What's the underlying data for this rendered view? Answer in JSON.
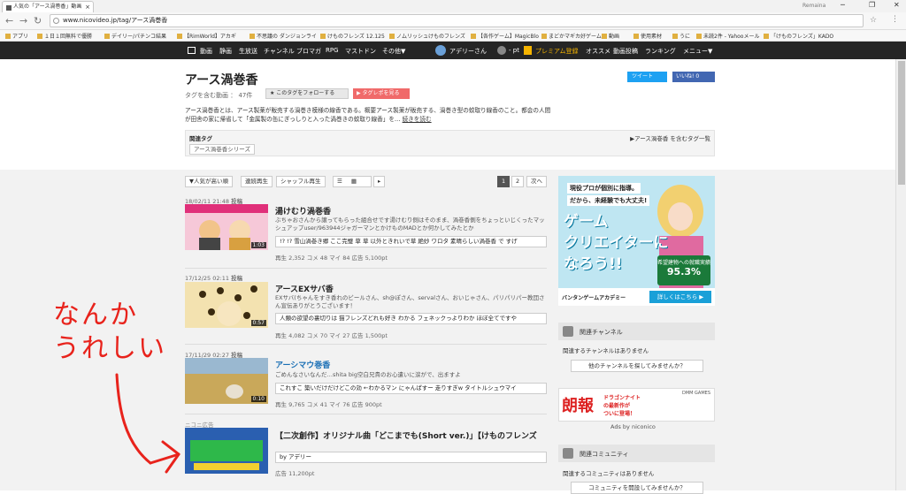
{
  "browser": {
    "tab_title": "人気の「アース渦巻香」動画",
    "tab_close": "×",
    "profile": "Remaina",
    "win_min": "─",
    "win_max": "❐",
    "win_close": "✕",
    "back": "←",
    "forward": "→",
    "reload": "↻",
    "url": "www.nicovideo.jp/tag/アース渦巻香",
    "bookmarks": [
      "アプリ",
      "１日１回無料で優勝",
      "デイリー/パチンコ結果",
      "【RimWorld】アカギ",
      "不思議の ダンジョンライ",
      "けものフレンズ 12.125",
      "ノムリッシュけものフレンズ",
      "【各作ゲーム】MagicBlo",
      "まどかマギカ好ゲーム",
      "動画",
      "使用素材",
      "うに",
      "未読2件 - Yahooメール",
      "「けものフレンズ」KADO"
    ]
  },
  "nicobar": {
    "items": [
      "動画",
      "静画",
      "生放送",
      "チャンネル",
      "ブロマガ",
      "RPG",
      "マストドン",
      "その他▼"
    ],
    "user": "アデリーさん",
    "points": "- pt",
    "premium": "プレミアム登録",
    "right_items": [
      "オススメ",
      "動画投稿",
      "ランキング",
      "メニュー▼"
    ]
  },
  "header": {
    "title": "アース渦巻香",
    "count": "タグを含む動画 ： 47件",
    "follow": "★ このタグをフォローする",
    "report": "▶ タグレポを見る",
    "tweet": "ツイート",
    "fb": "いいね! 0",
    "desc_line1": "アース渦巻香とは、アース製薬が販売する渦巻き模様の線香である。概要アース製薬が販売する、渦巻き型の蚊取り線香のこと。都会の人間",
    "desc_line2": "が田舎の家に帰省して「金属製の缶にぎっしりと入った渦巻きの蚊取り線香」を…",
    "desc_link": "続きを読む",
    "reltag_label": "関連タグ",
    "reltag_chip": "アース渦巻香シリーズ",
    "reltag_list": "▶アース渦巻香 を含むタグ一覧"
  },
  "sort": {
    "popular": "▼人気が高い順",
    "continuous": "連続再生",
    "shuffle": "シャッフル再生",
    "view_list": "☰",
    "view_grid": "▦",
    "more": "▸",
    "page1": "1",
    "page2": "2",
    "next": "次へ"
  },
  "videos": [
    {
      "date": "18/02/11 21:48",
      "posted": "投稿",
      "title": "湯けむり渦巻香",
      "desc": "ぶちゃおさんから譲ってもらった組合せです湯けむり側はそのまま、渦巻香側をちょっといじくったマッシュアップuser/963944ジャガーマンとかけものMADとか何かしてみたとか",
      "duration": "1:03",
      "comment": "!? !? 雪山渦巻き郷 ここ完璧 草 草 以外ときれいで草 絶妙 ワロタ 素晴らしい渦巻香 で すげ",
      "stats": "再生 2,352  コメ 48  マイ 84  広告 5,100pt"
    },
    {
      "date": "17/12/25 02:11",
      "posted": "投稿",
      "title": "アースEXサバ香",
      "desc": "EXサバ(ちゃんをすき香れのビールさん、sh@ぽさん、servalさん、おいじゃさん、パリパリパー教団さん宣伝ありがとうございます！",
      "duration": "0:57",
      "comment": "人類の欲望の裏切りは 猫フレンズどれも好き わかる フェネックっよりわか ほぼ全てですや",
      "stats": "再生 4,082  コメ 70  マイ 27  広告 1,500pt"
    },
    {
      "date": "17/11/29 02:27",
      "posted": "投稿",
      "title": "アーシマウ巻香",
      "desc": "ごめんなさいなんだ…shita big空白兄貴のお心遣いに涙がで、出ますよ",
      "duration": "0:10",
      "comment": "これすこ 築いだけだけどこの効 ←わかるマン にゃんぱすー 走りすぎw タイトルシュウマイ",
      "stats": "再生 9,765  コメ 41  マイ 76  広告 900pt"
    }
  ],
  "nicoad": {
    "label": "ニコニ広告",
    "title": "【二次創作】オリジナル曲「どこまでも(Short ver.)」【けものフレンズ",
    "by": "by アデリー",
    "stats": "広告 11,200pt"
  },
  "ad": {
    "line1": "現役プロが個別に指導。",
    "line2": "だから、未経験でも大丈夫!",
    "big1": "ゲーム",
    "big2": "クリエイターに",
    "big3": "なろう!!",
    "badge_top": "希望建物への就職実績",
    "badge_pct": "95.3%",
    "brand": "バンタンゲームアカデミー",
    "cta": "詳しくはこちら ▶"
  },
  "sidebar": {
    "channel_head": "関連チャンネル",
    "channel_text": "関連するチャンネルはありません",
    "channel_btn": "他のチャンネルを探してみませんか？",
    "ad2_big": "朗報",
    "ad2_sub1": "ドラゴンナイト",
    "ad2_sub2": "の最新作が",
    "ad2_sub3": "ついに登場！",
    "ad2_logo": "DMM GAMES",
    "adsby": "Ads by niconico",
    "community_head": "関連コミュニティ",
    "community_text": "関連するコミュニティはありません",
    "community_btn": "コミュニティを開設してみませんか？"
  },
  "annotation": {
    "line1": "なんか",
    "line2": "うれしい"
  },
  "colors": {
    "annotation": "#e8231c",
    "nicobar": "#252525",
    "premium": "#f5b400",
    "tweet": "#1da1f2",
    "fb": "#4267b2",
    "report": "#f06a6a"
  }
}
